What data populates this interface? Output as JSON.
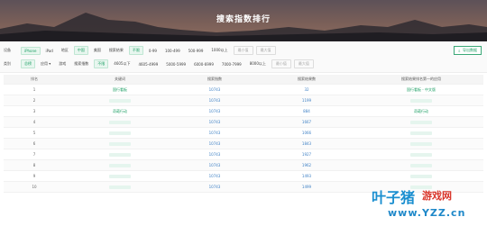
{
  "banner": {
    "title": "搜索指数排行"
  },
  "filters": {
    "row1": {
      "device_label": "设备",
      "devices": [
        "iPhone",
        "iPad"
      ],
      "region_label": "地区",
      "regions": [
        "中国",
        "美国"
      ],
      "result_label": "搜索结果",
      "results": [
        "不限",
        "0-99",
        "100-499",
        "500-999",
        "1000以上"
      ],
      "min_placeholder": "最小值",
      "max_placeholder": "最大值",
      "export_label": "导出数据"
    },
    "row2": {
      "category_label": "类别",
      "categories": [
        "总榜",
        "应用 ▾",
        "游戏"
      ],
      "index_label": "搜索指数",
      "indexes": [
        "不限",
        "4605以下",
        "4605-4999",
        "5000-5999",
        "6000-6999",
        "7000-7999",
        "8000以上"
      ],
      "min_placeholder": "最小值",
      "max_placeholder": "最大值"
    }
  },
  "table": {
    "headers": [
      "排名",
      "关键词",
      "搜索指数",
      "搜索结果数",
      "搜索结果排名第一的应用"
    ],
    "rows": [
      {
        "rank": "1",
        "keyword": "国行看板",
        "index": "10743",
        "results": "32",
        "top_app": "国行看板 - 中文版"
      },
      {
        "rank": "2",
        "keyword": "",
        "index": "10743",
        "results": "1199",
        "top_app": ""
      },
      {
        "rank": "3",
        "keyword": "奇葩行动",
        "index": "10743",
        "results": "884",
        "top_app": "奇葩行动"
      },
      {
        "rank": "4",
        "keyword": "",
        "index": "10743",
        "results": "1667",
        "top_app": ""
      },
      {
        "rank": "5",
        "keyword": "",
        "index": "10743",
        "results": "1066",
        "top_app": ""
      },
      {
        "rank": "6",
        "keyword": "",
        "index": "10743",
        "results": "1843",
        "top_app": ""
      },
      {
        "rank": "7",
        "keyword": "",
        "index": "10743",
        "results": "1927",
        "top_app": ""
      },
      {
        "rank": "8",
        "keyword": "",
        "index": "10743",
        "results": "1962",
        "top_app": ""
      },
      {
        "rank": "9",
        "keyword": "",
        "index": "10743",
        "results": "1493",
        "top_app": ""
      },
      {
        "rank": "10",
        "keyword": "",
        "index": "10743",
        "results": "1499",
        "top_app": ""
      }
    ]
  },
  "watermark": {
    "name": "叶子猪",
    "sub": "游戏网",
    "url": "www.YZZ.cn"
  }
}
